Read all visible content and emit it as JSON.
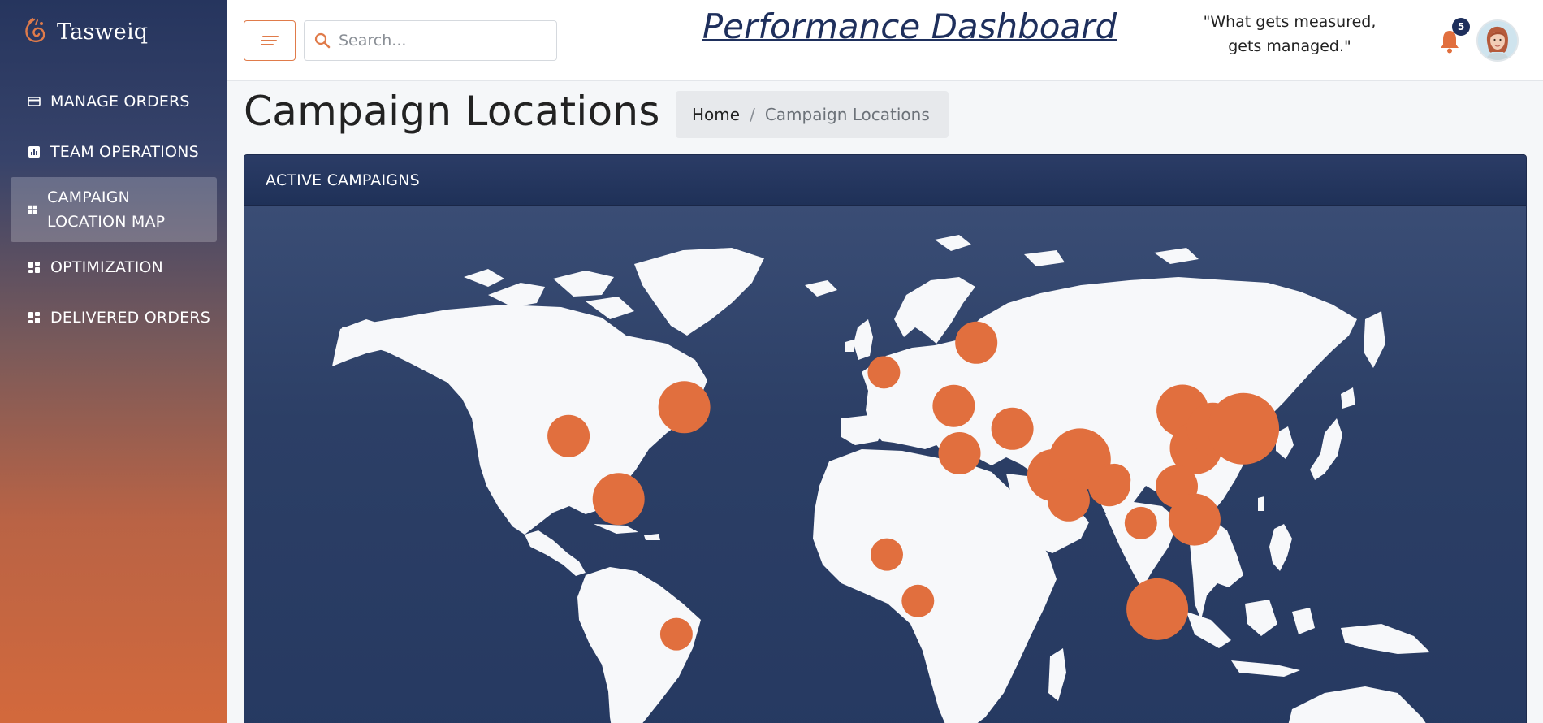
{
  "app": {
    "brand_name": "Tasweiq",
    "dashboard_title": "Performance Dashboard",
    "quote": "\"What gets measured, gets managed.\""
  },
  "sidebar": {
    "items": [
      {
        "label": "MANAGE ORDERS",
        "icon": "card-icon",
        "active": false
      },
      {
        "label": "TEAM OPERATIONS",
        "icon": "bar-chart-icon",
        "active": false
      },
      {
        "label": "CAMPAIGN LOCATION MAP",
        "icon": "grid-icon",
        "active": true
      },
      {
        "label": "OPTIMIZATION",
        "icon": "dashboard-icon",
        "active": false
      },
      {
        "label": "DELIVERED ORDERS",
        "icon": "dashboard-icon",
        "active": false
      }
    ]
  },
  "topbar": {
    "search_placeholder": "Search...",
    "notification_count": "5"
  },
  "page": {
    "title": "Campaign Locations",
    "breadcrumb": {
      "home": "Home",
      "current": "Campaign Locations"
    }
  },
  "card": {
    "header": "ACTIVE CAMPAIGNS"
  },
  "map": {
    "land_color": "#f7f8fa",
    "ocean_color": "#2c3f66",
    "marker_color": "#e16f3e",
    "markers": [
      {
        "lat": 40.7,
        "lon": -74.0,
        "size": 3
      },
      {
        "lat": 34.0,
        "lon": -118.2,
        "size": 2
      },
      {
        "lat": 19.4,
        "lon": -99.1,
        "size": 3
      },
      {
        "lat": -12.0,
        "lon": -77.0,
        "size": 1
      },
      {
        "lat": 48.8,
        "lon": 2.3,
        "size": 1
      },
      {
        "lat": 55.7,
        "lon": 37.6,
        "size": 2
      },
      {
        "lat": 41.0,
        "lon": 29.0,
        "size": 2
      },
      {
        "lat": 30.0,
        "lon": 31.2,
        "size": 2
      },
      {
        "lat": 35.7,
        "lon": 51.4,
        "size": 2
      },
      {
        "lat": 6.5,
        "lon": 3.4,
        "size": 1
      },
      {
        "lat": -4.3,
        "lon": 15.3,
        "size": 1
      },
      {
        "lat": 24.9,
        "lon": 67.0,
        "size": 3
      },
      {
        "lat": 28.6,
        "lon": 77.2,
        "size": 4
      },
      {
        "lat": 19.1,
        "lon": 72.9,
        "size": 2
      },
      {
        "lat": 22.6,
        "lon": 88.4,
        "size": 2
      },
      {
        "lat": 23.8,
        "lon": 90.4,
        "size": 1
      },
      {
        "lat": 13.8,
        "lon": 100.5,
        "size": 1
      },
      {
        "lat": -6.2,
        "lon": 106.8,
        "size": 4
      },
      {
        "lat": 39.9,
        "lon": 116.4,
        "size": 3
      },
      {
        "lat": 31.2,
        "lon": 121.5,
        "size": 3
      },
      {
        "lat": 22.3,
        "lon": 114.2,
        "size": 2
      },
      {
        "lat": 14.6,
        "lon": 121.0,
        "size": 3
      },
      {
        "lat": 35.7,
        "lon": 128.0,
        "size": 3
      },
      {
        "lat": 35.7,
        "lon": 139.7,
        "size": 5
      }
    ]
  }
}
